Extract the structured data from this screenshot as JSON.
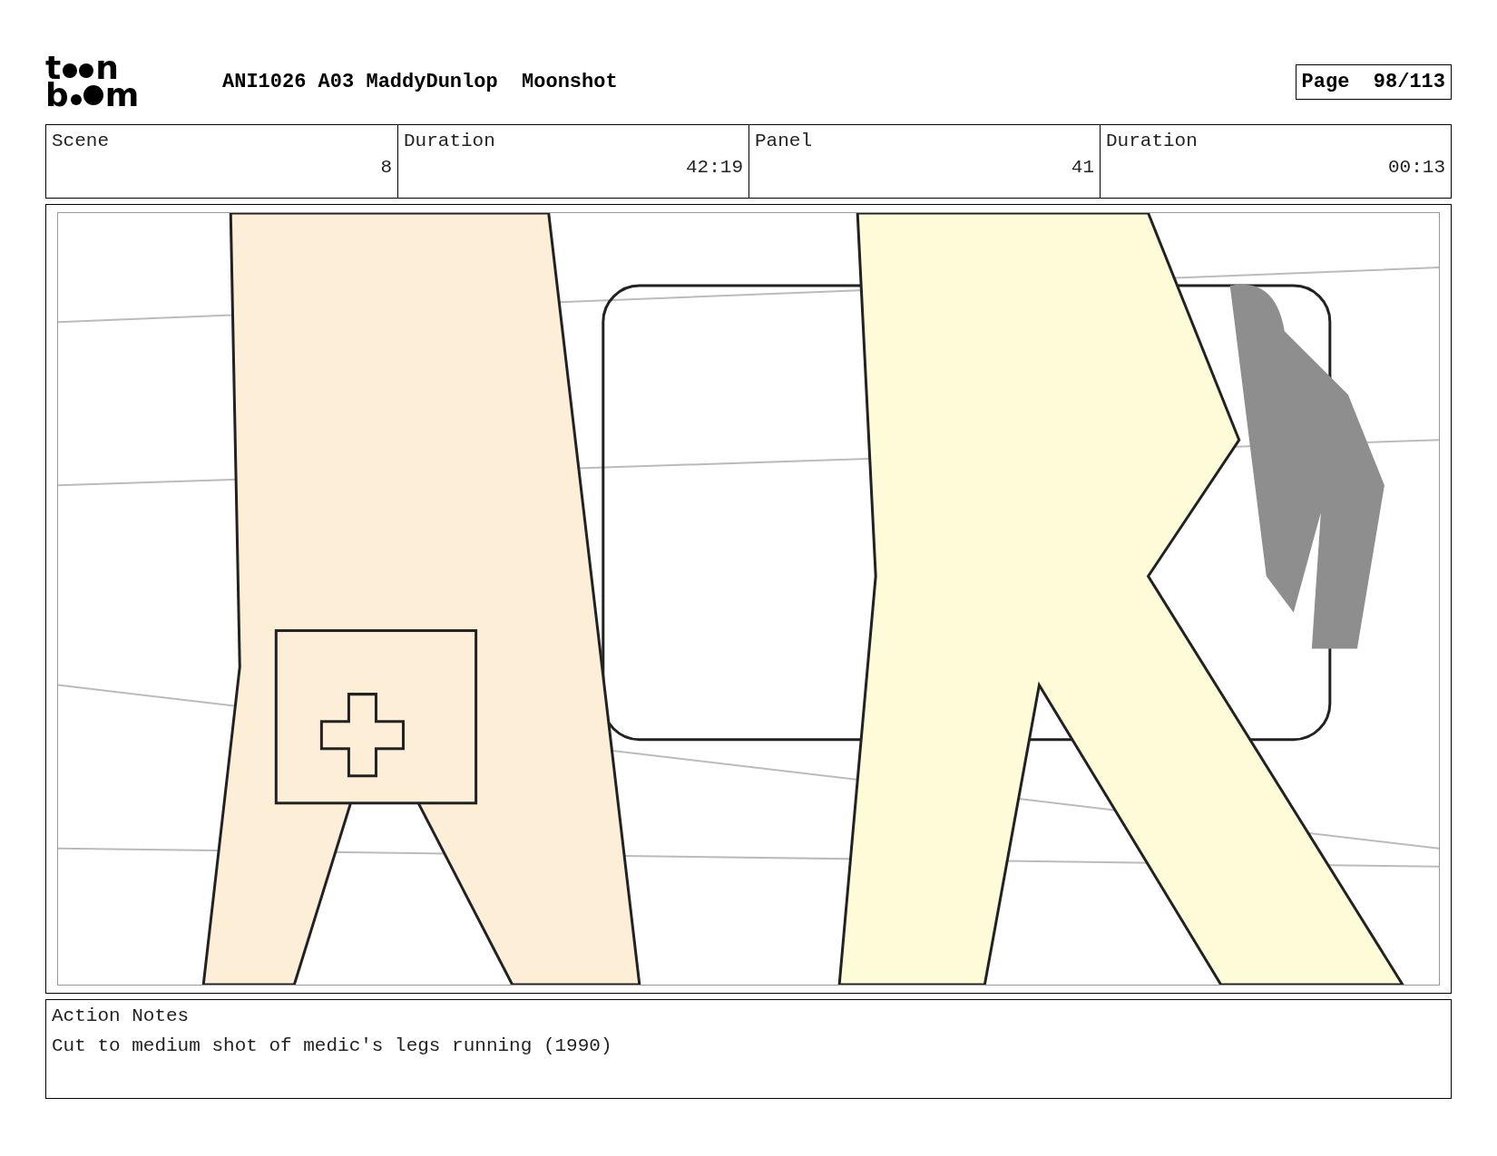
{
  "header": {
    "logo": {
      "top": [
        "t",
        "n"
      ],
      "bottom": [
        "b",
        "m"
      ]
    },
    "title": "ANI1026 A03 MaddyDunlop  Moonshot",
    "page": "Page  98/113"
  },
  "info_table": {
    "labels": [
      "Scene",
      "Duration",
      "Panel",
      "Duration"
    ],
    "values": [
      "8",
      "42:19",
      "41",
      "00:13"
    ]
  },
  "notes": {
    "label": "Action Notes",
    "text": "Cut to medium shot of medic's legs running (1990)"
  }
}
